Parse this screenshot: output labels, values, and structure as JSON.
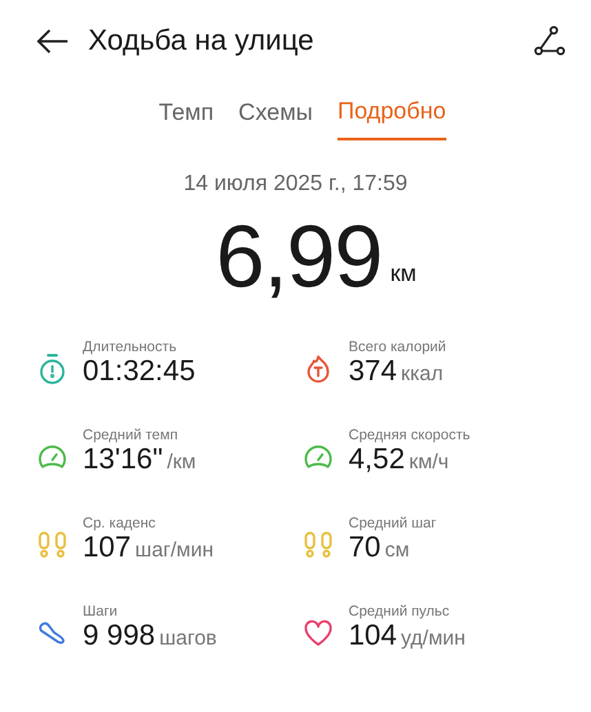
{
  "header": {
    "title": "Ходьба на улице"
  },
  "tabs": [
    {
      "label": "Темп",
      "selected": false
    },
    {
      "label": "Схемы",
      "selected": false
    },
    {
      "label": "Подробно",
      "selected": true
    }
  ],
  "date": "14 июля 2025 г., 17:59",
  "distance": {
    "value": "6,99",
    "unit": "км"
  },
  "stats": [
    {
      "kind": "stopwatch",
      "color": "#2bb59a",
      "label": "Длительность",
      "value": "01:32:45"
    },
    {
      "kind": "calories",
      "color": "#e8563a",
      "label": "Всего калорий",
      "value": "374",
      "unit": "ккал"
    },
    {
      "kind": "gauge",
      "color": "#4cbb4a",
      "label": "Средний темп",
      "value": "13'16\"",
      "unit": "/км"
    },
    {
      "kind": "gauge",
      "color": "#4cbb4a",
      "label": "Средняя скорость",
      "value": "4,52",
      "unit": "км/ч"
    },
    {
      "kind": "footprints",
      "color": "#e8c040",
      "label": "Ср. каденс",
      "value": "107",
      "unit": "шаг/мин"
    },
    {
      "kind": "footprints",
      "color": "#e8c040",
      "label": "Средний шаг",
      "value": "70",
      "unit": "см"
    },
    {
      "kind": "shoe",
      "color": "#3f7be0",
      "label": "Шаги",
      "value": "9 998",
      "unit": "шагов"
    },
    {
      "kind": "heart",
      "color": "#e8406a",
      "label": "Средний пульс",
      "value": "104",
      "unit": "уд/мин"
    }
  ]
}
